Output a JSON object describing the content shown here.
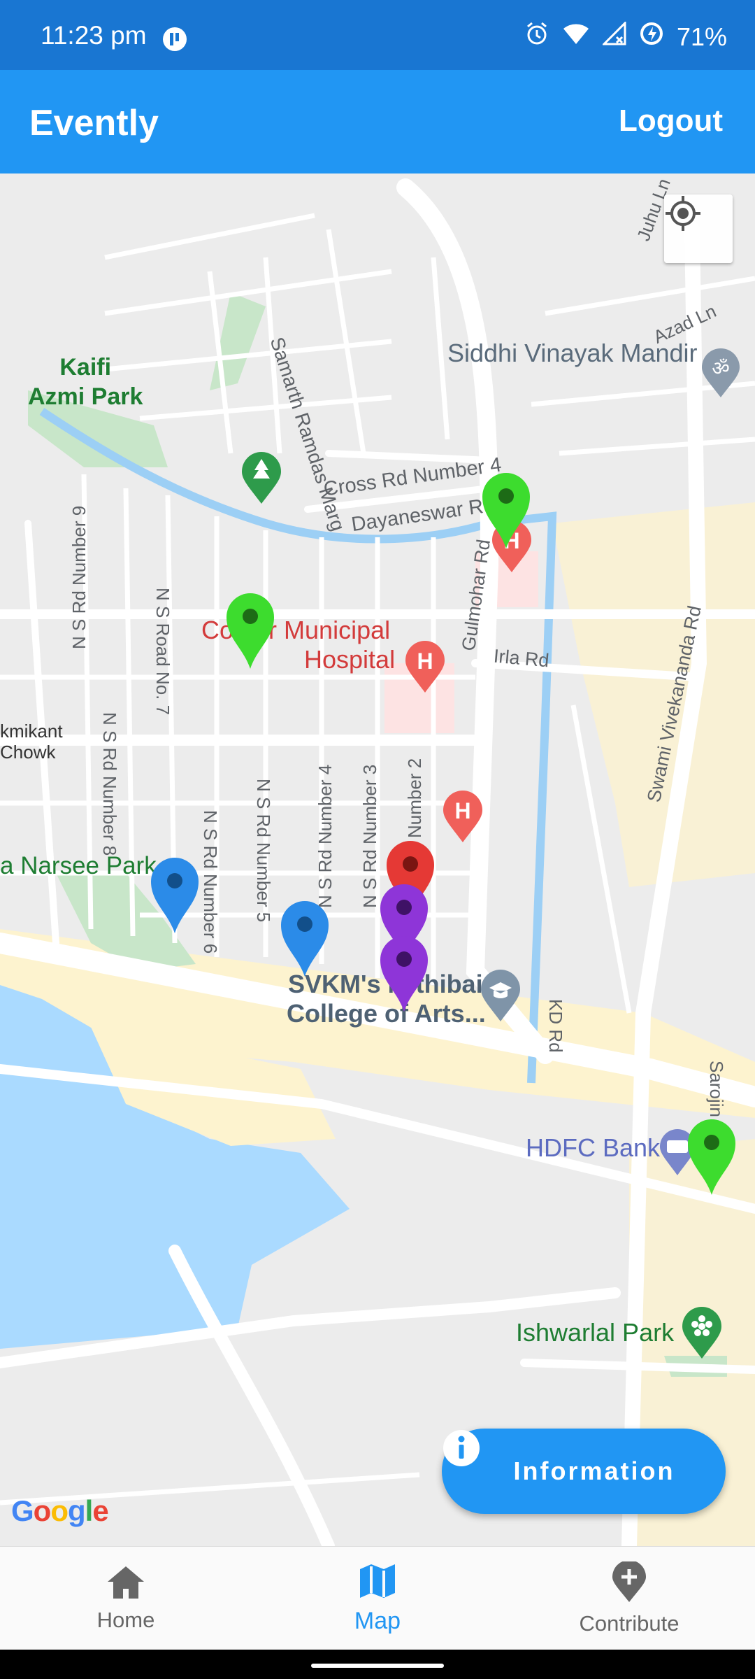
{
  "status_bar": {
    "time": "11:23 pm",
    "battery": "71%"
  },
  "app_bar": {
    "title": "Evently",
    "logout_label": "Logout"
  },
  "map": {
    "streets": [
      "Samarth Ramdas Marg",
      "Cross Rd Number 4",
      "Dayaneswar Rd",
      "Gulmohar Rd",
      "Irla Rd",
      "Swami Vivekananda Rd",
      "Juhu Ln",
      "Azad Ln",
      "N S Rd Number 9",
      "N S Rd Number 8",
      "N S Road No. 7",
      "N S Rd Number 6",
      "N S Rd Number 5",
      "N S Rd Number 4",
      "N S Rd Number 3",
      "Number 2",
      "KD Rd",
      "Sarojin",
      "kmikant",
      "Chowk"
    ],
    "places": {
      "kaifi_azmi_park": "Kaifi\nAzmi Park",
      "siddhi_vinayak": "Siddhi Vinayak Mandir",
      "cooper_hospital_line1": "Co   er Municipal",
      "cooper_hospital_line2": "Hospital",
      "narsee_park": "a Narsee Park",
      "svkm_line1": "SVKM's Mithibai",
      "svkm_line2": "College of Arts...",
      "hdfc_bank": "HDFC Bank",
      "ishwarlal_park": "Ishwarlal Park"
    },
    "markers": [
      {
        "name": "event-marker-green-1",
        "color": "#3ddc2e"
      },
      {
        "name": "event-marker-green-2",
        "color": "#3ddc2e"
      },
      {
        "name": "event-marker-green-3",
        "color": "#3ddc2e"
      },
      {
        "name": "event-marker-blue-1",
        "color": "#2b8be8"
      },
      {
        "name": "event-marker-blue-2",
        "color": "#2b8be8"
      },
      {
        "name": "event-marker-red-1",
        "color": "#e53935"
      },
      {
        "name": "event-marker-purple-1",
        "color": "#8e35d8"
      },
      {
        "name": "event-marker-purple-2",
        "color": "#8e35d8"
      }
    ],
    "google_logo": "Google"
  },
  "fab": {
    "label": "Information",
    "icon": "info-icon"
  },
  "bottom_nav": {
    "items": [
      {
        "label": "Home",
        "icon": "home-icon"
      },
      {
        "label": "Map",
        "icon": "map-icon",
        "active": true
      },
      {
        "label": "Contribute",
        "icon": "add-location-icon"
      }
    ]
  },
  "colors": {
    "primary": "#2196F3",
    "status_bar": "#1976D2",
    "water": "#aadaff",
    "park": "#c8e6c9"
  }
}
